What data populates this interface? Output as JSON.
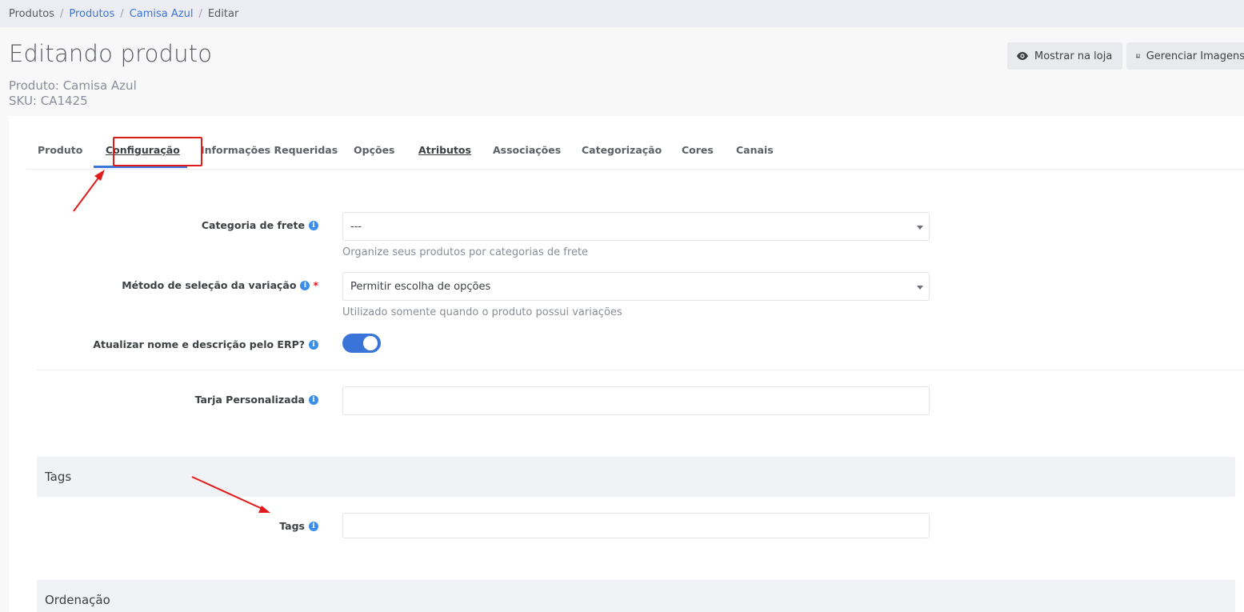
{
  "breadcrumb": {
    "items": [
      "Produtos",
      "Produtos",
      "Camisa Azul",
      "Editar"
    ],
    "separator": "/"
  },
  "header": {
    "title": "Editando produto",
    "product_line": "Produto: Camisa Azul",
    "sku_line": "SKU: CA1425",
    "show_store_label": "Mostrar na loja",
    "manage_images_label": "Gerenciar Imagens"
  },
  "tabs": [
    "Produto",
    "Configuração",
    "Informações Requeridas",
    "Opções",
    "Atributos",
    "Associações",
    "Categorização",
    "Cores",
    "Canais"
  ],
  "active_tab": "Configuração",
  "form": {
    "shipping_category": {
      "label": "Categoria de frete",
      "value": "---",
      "help": "Organize seus produtos por categorias de frete"
    },
    "variation_method": {
      "label": "Método de seleção da variação",
      "required_mark": "*",
      "value": "Permitir escolha de opções",
      "help": "Utilizado somente quando o produto possui variações"
    },
    "erp_update": {
      "label": "Atualizar nome e descrição pelo ERP?",
      "enabled": true
    },
    "custom_stripe": {
      "label": "Tarja Personalizada",
      "value": ""
    }
  },
  "sections": {
    "tags": {
      "title": "Tags",
      "field_label": "Tags",
      "value": ""
    },
    "ordering": {
      "title": "Ordenação"
    }
  },
  "icons": {
    "info": "i"
  },
  "colors": {
    "accent": "#3b74d8",
    "annotation": "#e01b1b",
    "info_icon": "#3b8ee8"
  }
}
